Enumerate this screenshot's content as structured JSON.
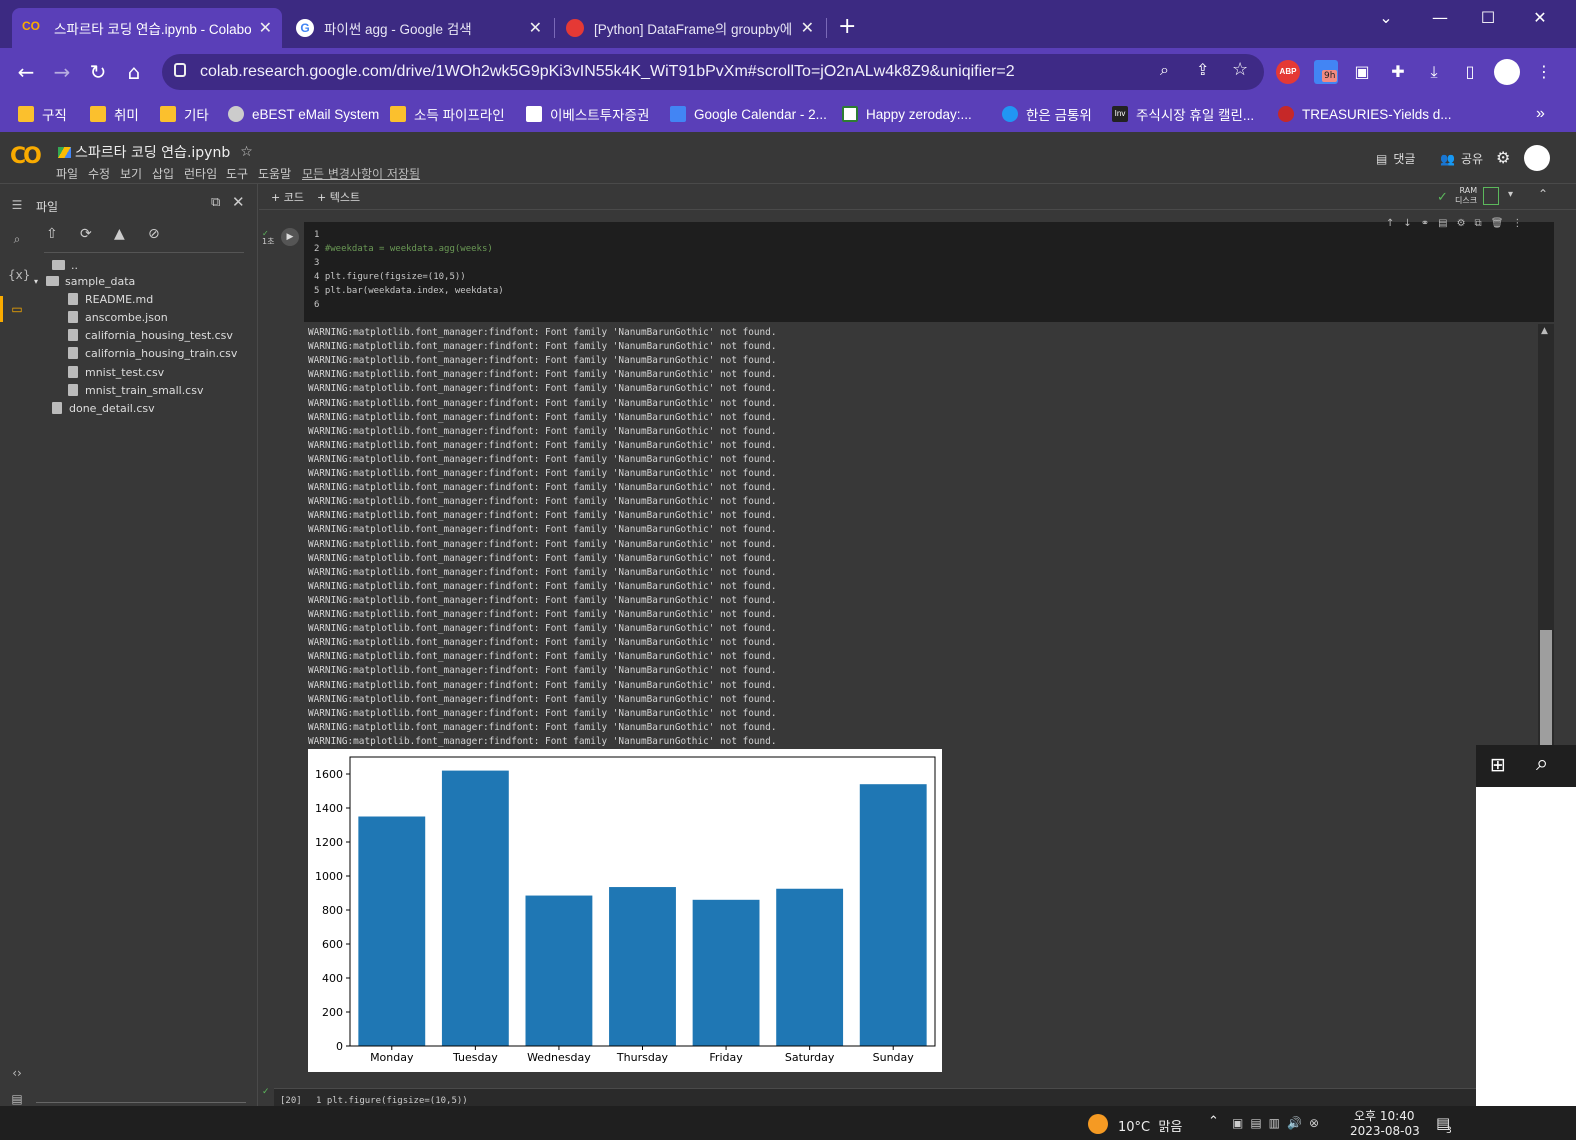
{
  "browser": {
    "tabs": [
      {
        "title": "스파르타 코딩 연습.ipynb - Colabo",
        "active": true
      },
      {
        "title": "파이썬 agg - Google 검색",
        "active": false
      },
      {
        "title": "[Python] DataFrame의 groupby에",
        "active": false
      }
    ],
    "new_tab": "+",
    "window_controls": [
      "⌄",
      "—",
      "☐",
      "✕"
    ],
    "url": "colab.research.google.com/drive/1WOh2wk5G9pKi3vIN55k4K_WiT91bPvXm#scrollTo=jO2nALw4k8Z9&uniqifier=2",
    "extensions": {
      "abp": "ABP",
      "calendar_badge": "9h"
    },
    "bookmarks": [
      "구직",
      "취미",
      "기타",
      "eBEST eMail System",
      "소득 파이프라인",
      "이베스트투자증권",
      "Google Calendar - 2...",
      "Happy zeroday:...",
      "한은 금통위",
      "주식시장 휴일 캘린...",
      "TREASURIES-Yields d..."
    ],
    "bookmarks_more": "»"
  },
  "colab": {
    "notebook_title": "스파르타 코딩 연습.ipynb",
    "menu": [
      "파일",
      "수정",
      "보기",
      "삽입",
      "런타임",
      "도구",
      "도움말"
    ],
    "saved_status": "모든 변경사항이 저장됨",
    "comment_label": "댓글",
    "share_label": "공유",
    "add_code": "+ 코드",
    "add_text": "+ 텍스트",
    "ram_label": "RAM",
    "disk_label": "디스크"
  },
  "sidebar": {
    "title": "파일",
    "parent": "..",
    "folder": "sample_data",
    "files": [
      "README.md",
      "anscombe.json",
      "california_housing_test.csv",
      "california_housing_train.csv",
      "mnist_test.csv",
      "mnist_train_small.csv"
    ],
    "root_file": "done_detail.csv"
  },
  "cell": {
    "exec_time": "1초",
    "lines": [
      {
        "n": "1",
        "code": ""
      },
      {
        "n": "2",
        "code": "#weekdata = weekdata.agg(weeks)"
      },
      {
        "n": "3",
        "code": ""
      },
      {
        "n": "4",
        "code": "plt.figure(figsize=(10,5))"
      },
      {
        "n": "5",
        "code": "plt.bar(weekdata.index, weekdata)"
      },
      {
        "n": "6",
        "code": ""
      }
    ],
    "warning_line": "WARNING:matplotlib.font_manager:findfont: Font family 'NanumBarunGothic' not found."
  },
  "next_cell": {
    "exec_count": "[20]",
    "code": "1 plt.figure(figsize=(10,5))"
  },
  "chart_data": {
    "type": "bar",
    "categories": [
      "Monday",
      "Tuesday",
      "Wednesday",
      "Thursday",
      "Friday",
      "Saturday",
      "Sunday"
    ],
    "values": [
      1350,
      1620,
      885,
      935,
      860,
      925,
      1540
    ],
    "yticks": [
      0,
      200,
      400,
      600,
      800,
      1000,
      1200,
      1400,
      1600
    ],
    "ylim": [
      0,
      1700
    ],
    "color": "#1f77b4",
    "title": "",
    "xlabel": "",
    "ylabel": ""
  },
  "taskbar": {
    "weather": "10°C  맑음",
    "time": "오후 10:40",
    "date": "2023-08-03",
    "notif_count": "3"
  }
}
